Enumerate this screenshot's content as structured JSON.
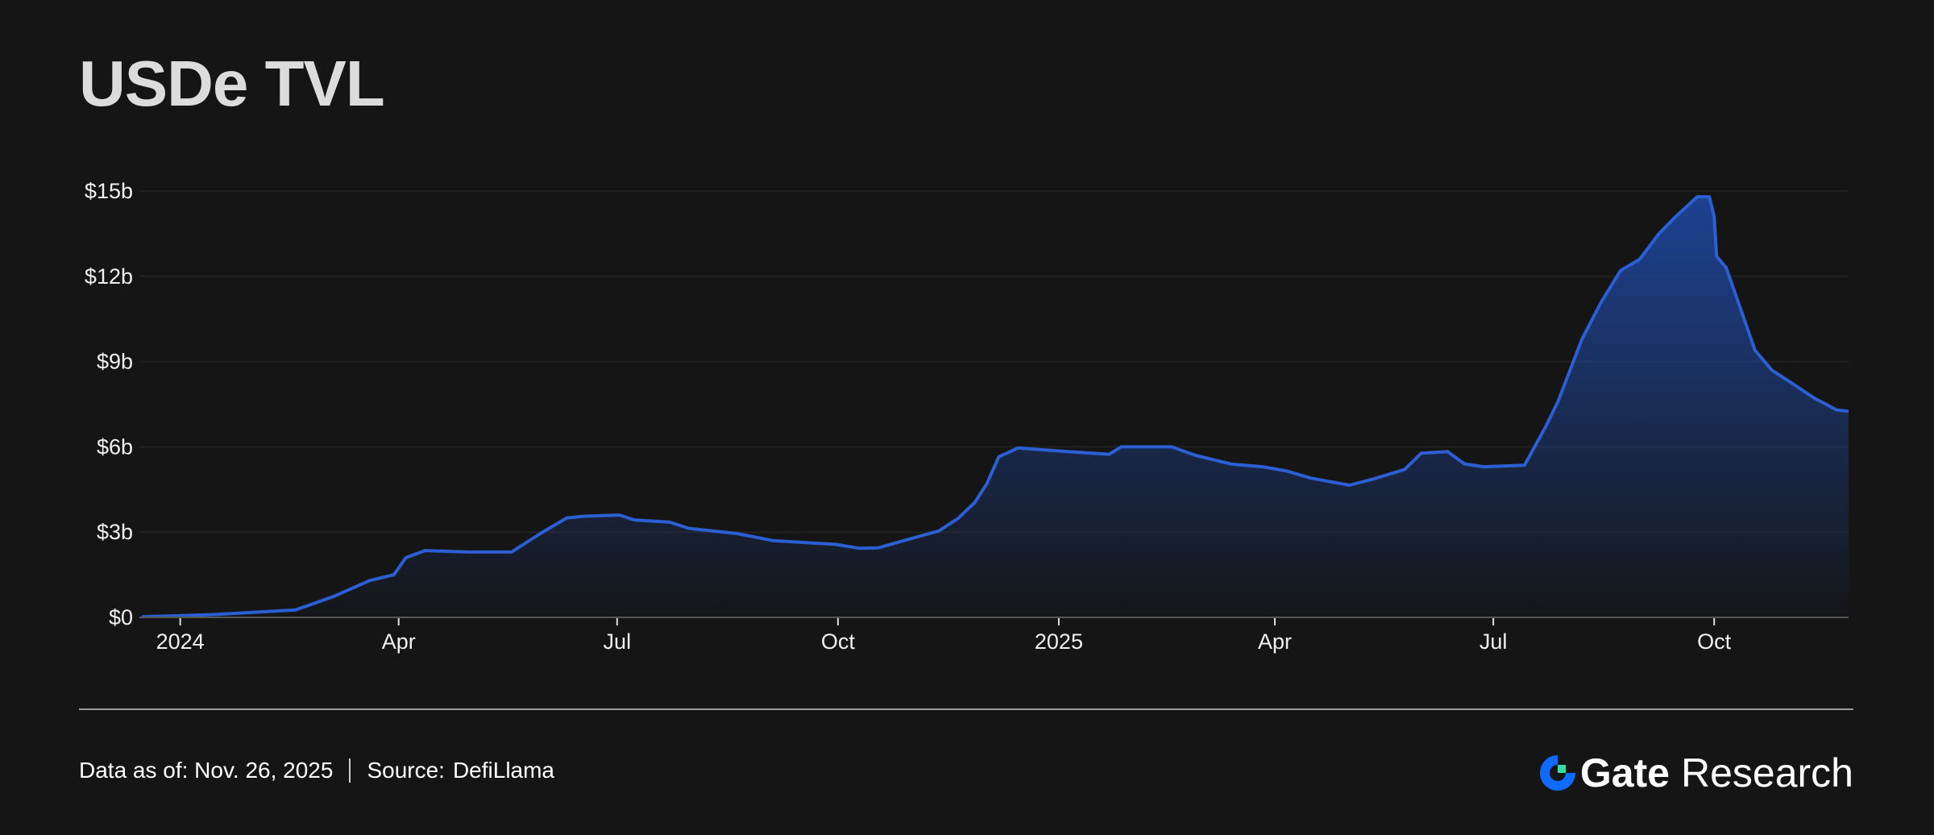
{
  "title": "USDe TVL",
  "footer": {
    "data_as_of": "Data as of: Nov. 26, 2025",
    "source_label": "Source:",
    "source": "DefiLlama"
  },
  "logo": {
    "brand": "Gate",
    "suffix": "Research"
  },
  "colors": {
    "line": "#2b5fd3",
    "fill": "#1f4aa8",
    "background": "#151515",
    "logo_blue": "#0f6bff",
    "logo_green": "#2fe0a0"
  },
  "chart_data": {
    "type": "area",
    "title": "USDe TVL",
    "xlabel": "",
    "ylabel": "",
    "unit": "USD billions",
    "xlim": [
      "2023-12-15",
      "2025-11-26"
    ],
    "ylim": [
      0,
      15
    ],
    "grid": true,
    "yticks": [
      {
        "value": 0,
        "label": "$0"
      },
      {
        "value": 3,
        "label": "$3b"
      },
      {
        "value": 6,
        "label": "$6b"
      },
      {
        "value": 9,
        "label": "$9b"
      },
      {
        "value": 12,
        "label": "$12b"
      },
      {
        "value": 15,
        "label": "$15b"
      }
    ],
    "xticks": [
      {
        "date": "2024-01-01",
        "label": "2024"
      },
      {
        "date": "2024-04-01",
        "label": "Apr"
      },
      {
        "date": "2024-07-01",
        "label": "Jul"
      },
      {
        "date": "2024-10-01",
        "label": "Oct"
      },
      {
        "date": "2025-01-01",
        "label": "2025"
      },
      {
        "date": "2025-04-01",
        "label": "Apr"
      },
      {
        "date": "2025-07-01",
        "label": "Jul"
      },
      {
        "date": "2025-10-01",
        "label": "Oct"
      }
    ],
    "series": [
      {
        "name": "USDe TVL",
        "points": [
          [
            "2023-12-16",
            0.02
          ],
          [
            "2024-01-15",
            0.1
          ],
          [
            "2024-02-18",
            0.26
          ],
          [
            "2024-03-05",
            0.74
          ],
          [
            "2024-03-20",
            1.3
          ],
          [
            "2024-03-30",
            1.5
          ],
          [
            "2024-04-04",
            2.1
          ],
          [
            "2024-04-12",
            2.35
          ],
          [
            "2024-04-30",
            2.3
          ],
          [
            "2024-05-18",
            2.3
          ],
          [
            "2024-05-30",
            2.95
          ],
          [
            "2024-06-10",
            3.5
          ],
          [
            "2024-06-17",
            3.56
          ],
          [
            "2024-07-02",
            3.6
          ],
          [
            "2024-07-08",
            3.43
          ],
          [
            "2024-07-23",
            3.35
          ],
          [
            "2024-07-31",
            3.13
          ],
          [
            "2024-08-20",
            2.95
          ],
          [
            "2024-09-04",
            2.7
          ],
          [
            "2024-09-30",
            2.57
          ],
          [
            "2024-10-10",
            2.43
          ],
          [
            "2024-10-18",
            2.45
          ],
          [
            "2024-10-30",
            2.74
          ],
          [
            "2024-11-12",
            3.04
          ],
          [
            "2024-11-20",
            3.48
          ],
          [
            "2024-11-27",
            4.04
          ],
          [
            "2024-12-02",
            4.7
          ],
          [
            "2024-12-07",
            5.65
          ],
          [
            "2024-12-15",
            5.96
          ],
          [
            "2025-01-05",
            5.83
          ],
          [
            "2025-01-22",
            5.74
          ],
          [
            "2025-01-27",
            6.0
          ],
          [
            "2025-02-17",
            6.0
          ],
          [
            "2025-02-27",
            5.7
          ],
          [
            "2025-03-14",
            5.39
          ],
          [
            "2025-03-27",
            5.3
          ],
          [
            "2025-04-06",
            5.15
          ],
          [
            "2025-04-16",
            4.9
          ],
          [
            "2025-05-02",
            4.65
          ],
          [
            "2025-05-12",
            4.87
          ],
          [
            "2025-05-25",
            5.2
          ],
          [
            "2025-06-01",
            5.78
          ],
          [
            "2025-06-12",
            5.83
          ],
          [
            "2025-06-19",
            5.4
          ],
          [
            "2025-06-27",
            5.3
          ],
          [
            "2025-07-14",
            5.35
          ],
          [
            "2025-07-23",
            6.74
          ],
          [
            "2025-07-28",
            7.6
          ],
          [
            "2025-08-02",
            8.7
          ],
          [
            "2025-08-07",
            9.8
          ],
          [
            "2025-08-15",
            11.1
          ],
          [
            "2025-08-23",
            12.2
          ],
          [
            "2025-08-31",
            12.6
          ],
          [
            "2025-09-08",
            13.5
          ],
          [
            "2025-09-15",
            14.1
          ],
          [
            "2025-09-24",
            14.8
          ],
          [
            "2025-09-29",
            14.8
          ],
          [
            "2025-10-01",
            14.1
          ],
          [
            "2025-10-02",
            12.7
          ],
          [
            "2025-10-06",
            12.3
          ],
          [
            "2025-10-11",
            11.1
          ],
          [
            "2025-10-18",
            9.4
          ],
          [
            "2025-10-25",
            8.7
          ],
          [
            "2025-11-02",
            8.26
          ],
          [
            "2025-11-12",
            7.7
          ],
          [
            "2025-11-21",
            7.3
          ],
          [
            "2025-11-26",
            7.25
          ]
        ]
      }
    ]
  }
}
